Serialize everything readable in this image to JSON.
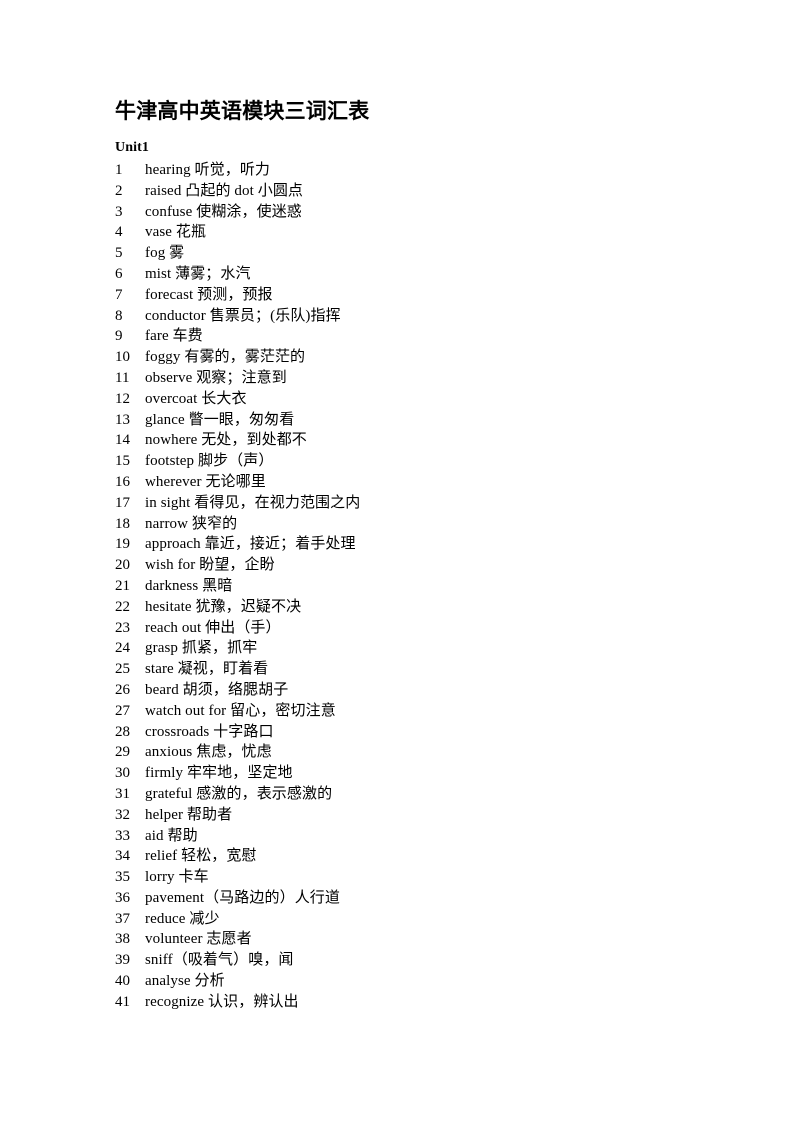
{
  "document": {
    "title": "牛津高中英语模块三词汇表",
    "unit_heading": "Unit1"
  },
  "vocabulary": [
    {
      "index": "1",
      "entry": "hearing 听觉，听力"
    },
    {
      "index": "2",
      "entry": "raised 凸起的  dot 小圆点"
    },
    {
      "index": "3",
      "entry": "confuse 使糊涂，使迷惑"
    },
    {
      "index": "4",
      "entry": "vase 花瓶"
    },
    {
      "index": "5",
      "entry": "fog 雾"
    },
    {
      "index": "6",
      "entry": "mist 薄雾；水汽"
    },
    {
      "index": "7",
      "entry": "forecast 预测，预报"
    },
    {
      "index": "8",
      "entry": "conductor 售票员；(乐队)指挥"
    },
    {
      "index": "9",
      "entry": "fare 车费"
    },
    {
      "index": "10",
      "entry": "foggy 有雾的，雾茫茫的"
    },
    {
      "index": "11",
      "entry": "observe 观察；注意到"
    },
    {
      "index": "12",
      "entry": "overcoat 长大衣"
    },
    {
      "index": "13",
      "entry": "glance 瞥一眼，匆匆看"
    },
    {
      "index": "14",
      "entry": "nowhere 无处，到处都不"
    },
    {
      "index": "15",
      "entry": "footstep 脚步（声）"
    },
    {
      "index": "16",
      "entry": "wherever 无论哪里"
    },
    {
      "index": "17",
      "entry": "in sight 看得见，在视力范围之内"
    },
    {
      "index": "18",
      "entry": "narrow 狭窄的"
    },
    {
      "index": "19",
      "entry": "approach 靠近，接近；着手处理"
    },
    {
      "index": "20",
      "entry": "wish for 盼望，企盼"
    },
    {
      "index": "21",
      "entry": "darkness 黑暗"
    },
    {
      "index": "22",
      "entry": "hesitate 犹豫，迟疑不决"
    },
    {
      "index": "23",
      "entry": "reach out 伸出（手）"
    },
    {
      "index": "24",
      "entry": "grasp 抓紧，抓牢"
    },
    {
      "index": "25",
      "entry": "stare 凝视，盯着看"
    },
    {
      "index": "26",
      "entry": "beard 胡须，络腮胡子"
    },
    {
      "index": "27",
      "entry": "watch out for 留心，密切注意"
    },
    {
      "index": "28",
      "entry": "crossroads 十字路口"
    },
    {
      "index": "29",
      "entry": "anxious 焦虑，忧虑"
    },
    {
      "index": "30",
      "entry": "firmly 牢牢地，坚定地"
    },
    {
      "index": "31",
      "entry": "grateful 感激的，表示感激的"
    },
    {
      "index": "32",
      "entry": "helper 帮助者"
    },
    {
      "index": "33",
      "entry": "aid 帮助"
    },
    {
      "index": "34",
      "entry": "relief 轻松，宽慰"
    },
    {
      "index": "35",
      "entry": "lorry 卡车"
    },
    {
      "index": "36",
      "entry": "pavement（马路边的）人行道"
    },
    {
      "index": "37",
      "entry": "reduce 减少"
    },
    {
      "index": "38",
      "entry": "volunteer 志愿者"
    },
    {
      "index": "39",
      "entry": "sniff（吸着气）嗅，闻"
    },
    {
      "index": "40",
      "entry": "analyse 分析"
    },
    {
      "index": "41",
      "entry": "recognize 认识，辨认出"
    }
  ]
}
